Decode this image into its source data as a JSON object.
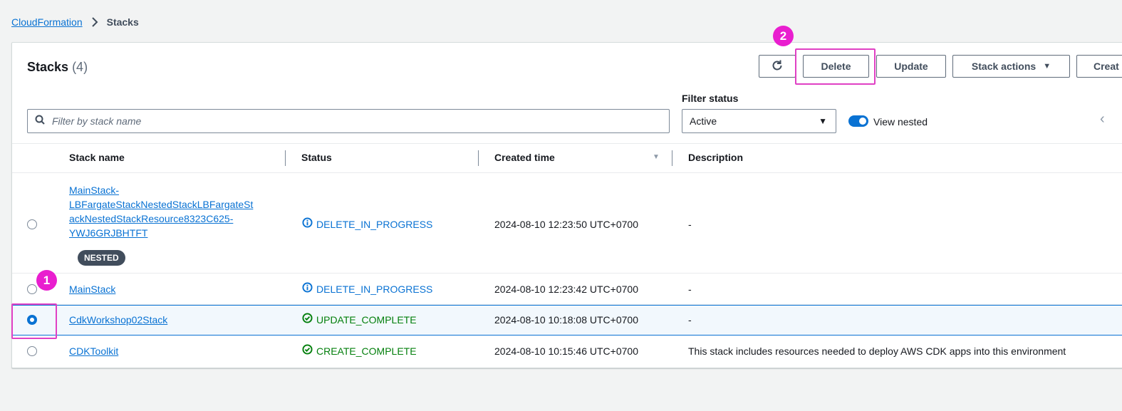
{
  "breadcrumb": {
    "root": "CloudFormation",
    "current": "Stacks"
  },
  "header": {
    "title": "Stacks",
    "count": "(4)"
  },
  "toolbar": {
    "delete_label": "Delete",
    "update_label": "Update",
    "stack_actions_label": "Stack actions",
    "create_label": "Creat"
  },
  "filters": {
    "search_placeholder": "Filter by stack name",
    "status_label": "Filter status",
    "status_value": "Active",
    "view_nested_label": "View nested",
    "view_nested_on": true
  },
  "table": {
    "columns": [
      "Stack name",
      "Status",
      "Created time",
      "Description"
    ],
    "rows": [
      {
        "name_lines": [
          "MainStack-",
          "LBFargateStackNestedStackLBFargateSt",
          "ackNestedStackResource8323C625-",
          "YWJ6GRJBHTFT"
        ],
        "badge": "NESTED",
        "status": "DELETE_IN_PROGRESS",
        "created": "2024-08-10 12:23:50 UTC+0700",
        "description": "-",
        "selected": false
      },
      {
        "name": "MainStack",
        "status": "DELETE_IN_PROGRESS",
        "created": "2024-08-10 12:23:42 UTC+0700",
        "description": "-",
        "selected": false
      },
      {
        "name": "CdkWorkshop02Stack",
        "status": "UPDATE_COMPLETE",
        "created": "2024-08-10 10:18:08 UTC+0700",
        "description": "-",
        "selected": true
      },
      {
        "name": "CDKToolkit",
        "status": "CREATE_COMPLETE",
        "created": "2024-08-10 10:15:46 UTC+0700",
        "description": "This stack includes resources needed to deploy AWS CDK apps into this environment",
        "selected": false
      }
    ]
  },
  "annotations": {
    "step1": "1",
    "step2": "2"
  },
  "colors": {
    "link": "#0972d3",
    "success": "#037f0c",
    "annotation": "#e91ecf"
  }
}
